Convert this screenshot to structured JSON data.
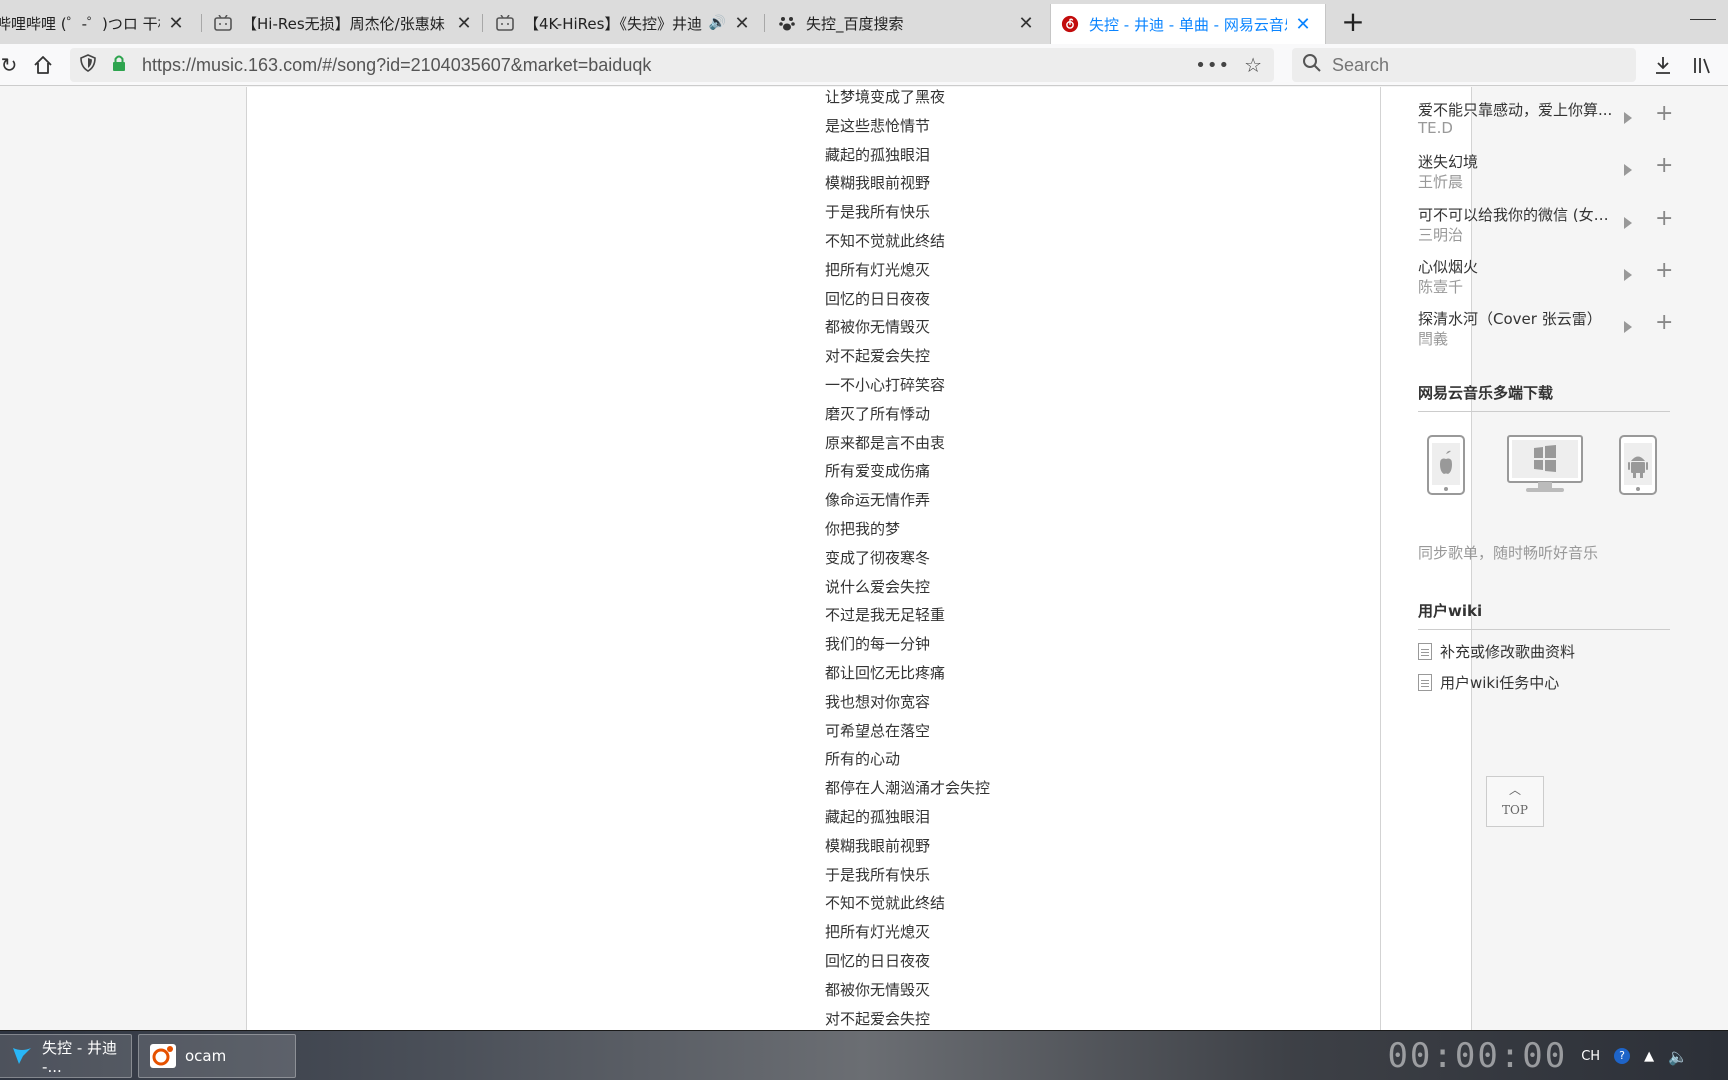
{
  "browser": {
    "tabs": [
      {
        "title": "哔哩哔哩 (゜-゜)つロ 干杯~-bilibili",
        "has_speaker": false
      },
      {
        "title": "【Hi-Res无损】周杰伦/张惠妹",
        "has_speaker": false
      },
      {
        "title": "【4K-HiRes】《失控》井迪",
        "has_speaker": true
      },
      {
        "title": "失控_百度搜索",
        "has_speaker": false
      },
      {
        "title": "失控 - 井迪 - 单曲 - 网易云音乐",
        "has_speaker": false
      }
    ],
    "active_tab": 4,
    "url": "https://music.163.com/#/song?id=2104035607&market=baiduqk",
    "search_placeholder": "Search"
  },
  "lyrics": [
    "让梦境变成了黑夜",
    "是这些悲怆情节",
    "藏起的孤独眼泪",
    "模糊我眼前视野",
    "于是我所有快乐",
    "不知不觉就此终结",
    "把所有灯光熄灭",
    "回忆的日日夜夜",
    "都被你无情毁灭",
    "对不起爱会失控",
    "一不小心打碎笑容",
    "磨灭了所有悸动",
    "原来都是言不由衷",
    "所有爱变成伤痛",
    "像命运无情作弄",
    "你把我的梦",
    "变成了彻夜寒冬",
    "说什么爱会失控",
    "不过是我无足轻重",
    "我们的每一分钟",
    "都让回忆无比疼痛",
    "我也想对你宽容",
    "可希望总在落空",
    "所有的心动",
    "都停在人潮汹涌才会失控",
    "藏起的孤独眼泪",
    "模糊我眼前视野",
    "于是我所有快乐",
    "不知不觉就此终结",
    "把所有灯光熄灭",
    "回忆的日日夜夜",
    "都被你无情毁灭",
    "对不起爱会失控"
  ],
  "similar_songs": [
    {
      "name": "爱不能只靠感动，爱上你算...",
      "artist": "TE.D"
    },
    {
      "name": "迷失幻境",
      "artist": "王忻晨"
    },
    {
      "name": "可不可以给我你的微信 (女版)",
      "artist": "三明治"
    },
    {
      "name": "心似烟火",
      "artist": "陈壹千"
    },
    {
      "name": "探清水河（Cover 张云雷）",
      "artist": "閆義"
    }
  ],
  "download": {
    "title": "网易云音乐多端下载",
    "desc": "同步歌单，随时畅听好音乐",
    "platforms": [
      "apple-icon",
      "windows-icon",
      "android-icon"
    ]
  },
  "wiki": {
    "title": "用户wiki",
    "items": [
      "补充或修改歌曲资料",
      "用户wiki任务中心"
    ]
  },
  "back_to_top": {
    "label": "TOP"
  },
  "taskbar": {
    "items": [
      {
        "label": "失控 - 井迪 -..."
      },
      {
        "label": "ocam"
      }
    ],
    "tray": {
      "lang": "CH",
      "clock": "00:00:00"
    }
  },
  "colors": {
    "accent": "#0a84ff",
    "netease_red": "#c20c0c"
  }
}
